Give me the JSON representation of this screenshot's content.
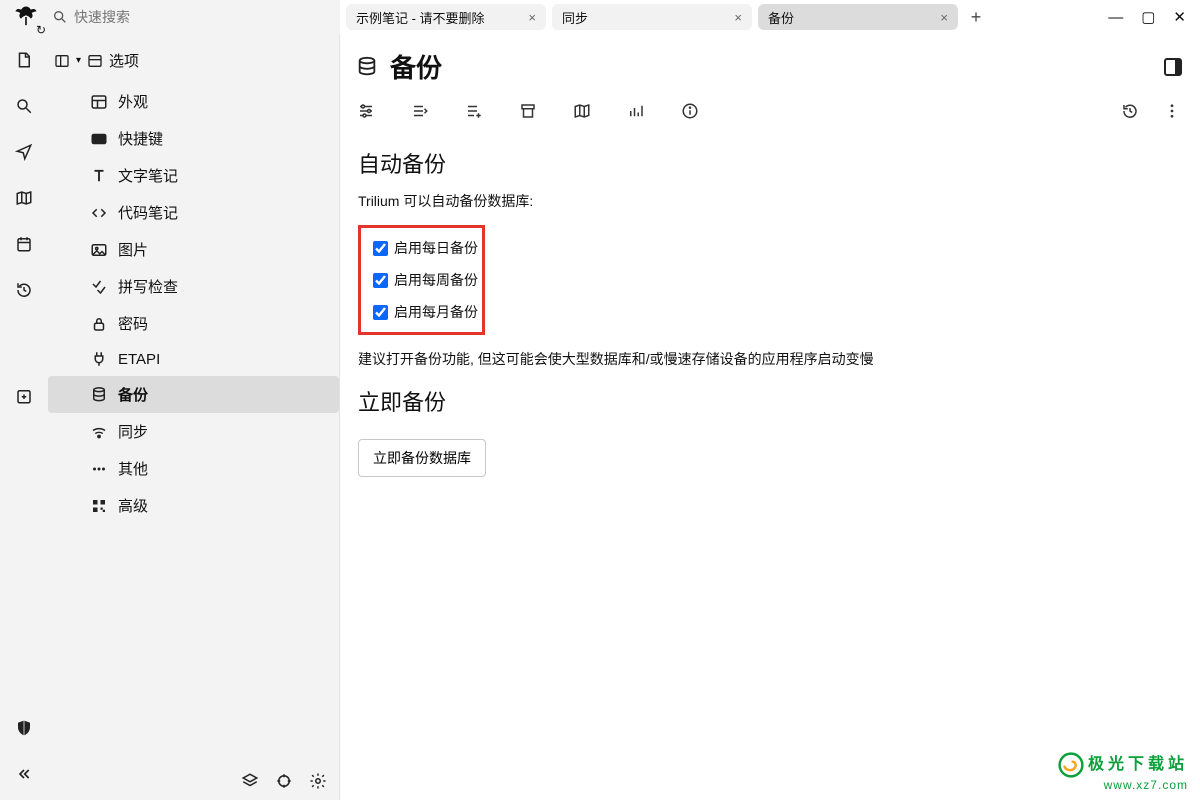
{
  "search": {
    "placeholder": "快速搜索"
  },
  "tabs": [
    {
      "label": "示例笔记 - 请不要删除",
      "active": false
    },
    {
      "label": "同步",
      "active": false
    },
    {
      "label": "备份",
      "active": true
    }
  ],
  "tree": {
    "root_label": "选项",
    "items": [
      {
        "key": "appearance",
        "label": "外观",
        "icon": "layout"
      },
      {
        "key": "shortcuts",
        "label": "快捷键",
        "icon": "keyboard"
      },
      {
        "key": "textnotes",
        "label": "文字笔记",
        "icon": "text"
      },
      {
        "key": "codenotes",
        "label": "代码笔记",
        "icon": "code"
      },
      {
        "key": "images",
        "label": "图片",
        "icon": "image"
      },
      {
        "key": "spell",
        "label": "拼写检查",
        "icon": "check"
      },
      {
        "key": "password",
        "label": "密码",
        "icon": "lock"
      },
      {
        "key": "etapi",
        "label": "ETAPI",
        "icon": "plug"
      },
      {
        "key": "backup",
        "label": "备份",
        "icon": "db",
        "active": true
      },
      {
        "key": "sync",
        "label": "同步",
        "icon": "wifi"
      },
      {
        "key": "other",
        "label": "其他",
        "icon": "dots"
      },
      {
        "key": "advanced",
        "label": "高级",
        "icon": "grid"
      }
    ]
  },
  "page": {
    "title": "备份",
    "auto_backup_heading": "自动备份",
    "auto_backup_desc": "Trilium 可以自动备份数据库:",
    "checks": {
      "daily": "启用每日备份",
      "weekly": "启用每周备份",
      "monthly": "启用每月备份"
    },
    "auto_backup_note": "建议打开备份功能, 但这可能会使大型数据库和/或慢速存储设备的应用程序启动变慢",
    "immediate_heading": "立即备份",
    "backup_button": "立即备份数据库"
  },
  "watermark": {
    "name": "极光下载站",
    "url": "www.xz7.com"
  }
}
